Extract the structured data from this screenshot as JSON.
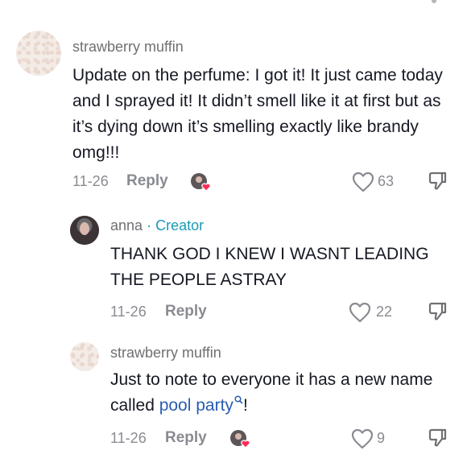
{
  "comments": [
    {
      "username": "strawberry muffin",
      "text": "Update on the perfume: I got it! It just came today and I sprayed it! It didn’t smell like it at first but as it’s dying down it’s smelling exactly like brandy omg!!!",
      "date": "11-26",
      "reply_label": "Reply",
      "likes": "63"
    },
    {
      "username": "anna",
      "separator": "·",
      "creator_label": "Creator",
      "text": "THANK GOD I KNEW I WASNT LEADING THE PEOPLE ASTRAY",
      "date": "11-26",
      "reply_label": "Reply",
      "likes": "22"
    },
    {
      "username": "strawberry muffin",
      "text_before": "Just to note to everyone it has a new name called ",
      "link_text": "pool party",
      "text_after": "!",
      "date": "11-26",
      "reply_label": "Reply",
      "likes": "9"
    }
  ],
  "colors": {
    "creator": "#1a9ab7",
    "link": "#2a5db0",
    "muted": "#8a8b91",
    "creator_heart": "#fe2c55"
  },
  "icons": [
    "heart-outline-icon",
    "dislike-icon",
    "search-icon",
    "creator-liked-badge"
  ]
}
